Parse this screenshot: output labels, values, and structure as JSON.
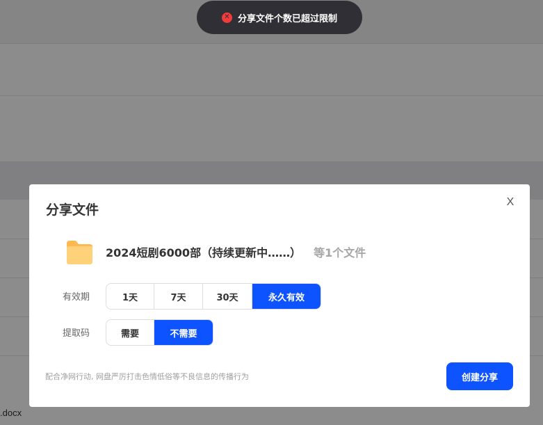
{
  "toast": {
    "message": "分享文件个数已超过限制",
    "icon": "error-icon"
  },
  "background": {
    "file_name_fragment": ".docx"
  },
  "dialog": {
    "title": "分享文件",
    "close_label": "X",
    "file": {
      "name": "2024短剧6000部（持续更新中……）",
      "count_text": "等1个文件",
      "icon": "folder-icon"
    },
    "validity": {
      "label": "有效期",
      "options": [
        "1天",
        "7天",
        "30天",
        "永久有效"
      ],
      "selected": "永久有效"
    },
    "code": {
      "label": "提取码",
      "options": [
        "需要",
        "不需要"
      ],
      "selected": "不需要"
    },
    "note": "配合净网行动, 网盘严厉打击色情低俗等不良信息的传播行为",
    "create_label": "创建分享"
  },
  "colors": {
    "accent": "#0d53ff",
    "toast_bg": "#2f2f35",
    "error": "#f23c3c",
    "folder": "#ffc766"
  }
}
